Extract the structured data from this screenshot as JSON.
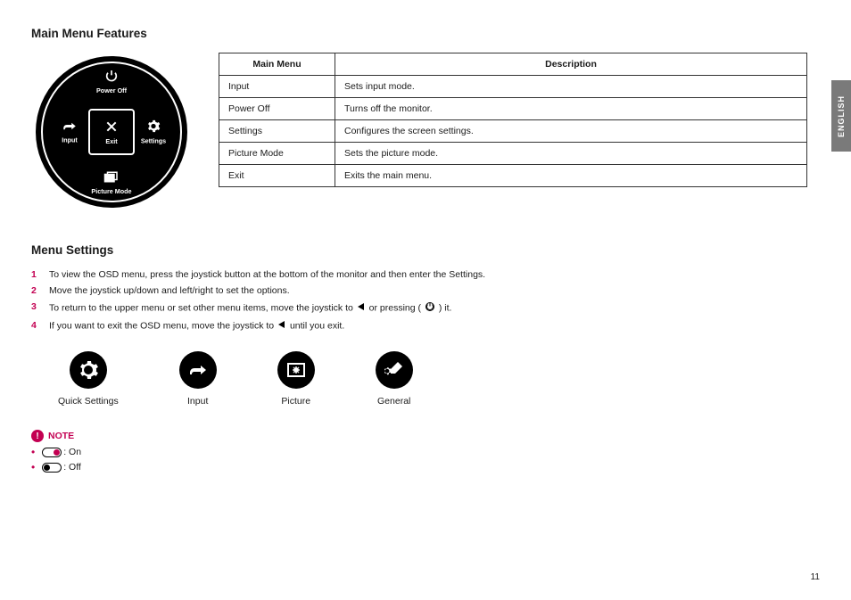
{
  "language_tab": "ENGLISH",
  "page_number": "11",
  "section1_title": "Main Menu Features",
  "dial": {
    "top": {
      "icon": "power-icon",
      "label": "Power Off"
    },
    "left": {
      "icon": "input-icon",
      "label": "Input"
    },
    "right": {
      "icon": "gear-icon",
      "label": "Settings"
    },
    "bottom": {
      "icon": "picture-mode-icon",
      "label": "Picture Mode"
    },
    "center": {
      "icon": "close-x-icon",
      "label": "Exit"
    }
  },
  "table": {
    "head_left": "Main Menu",
    "head_right": "Description",
    "rows": [
      {
        "name": "Input",
        "desc": "Sets input mode."
      },
      {
        "name": "Power Off",
        "desc": "Turns off the monitor."
      },
      {
        "name": "Settings",
        "desc": "Configures the screen settings."
      },
      {
        "name": "Picture Mode",
        "desc": "Sets the picture mode."
      },
      {
        "name": "Exit",
        "desc": "Exits the main menu."
      }
    ]
  },
  "section2_title": "Menu Settings",
  "instructions": [
    {
      "n": "1",
      "text_a": "To view the OSD menu, press the joystick button at the bottom of the monitor and then enter the Settings."
    },
    {
      "n": "2",
      "text_a": "Move the joystick up/down and left/right to set the options."
    },
    {
      "n": "3",
      "text_a": "To return to the upper menu or set other menu items, move the joystick to ",
      "icon1": "triangle-left-icon",
      "text_b": " or pressing (",
      "icon2": "joystick-icon",
      "text_c": ") it."
    },
    {
      "n": "4",
      "text_a": "If you want to exit the OSD menu, move the joystick to ",
      "icon1": "triangle-left-icon",
      "text_b": " until you exit."
    }
  ],
  "icon_row": [
    {
      "icon": "quick-settings-icon",
      "label": "Quick Settings"
    },
    {
      "icon": "input-icon",
      "label": "Input"
    },
    {
      "icon": "picture-icon",
      "label": "Picture"
    },
    {
      "icon": "general-icon",
      "label": "General"
    }
  ],
  "note": {
    "title": "NOTE",
    "on_label": ": On",
    "off_label": ": Off"
  }
}
